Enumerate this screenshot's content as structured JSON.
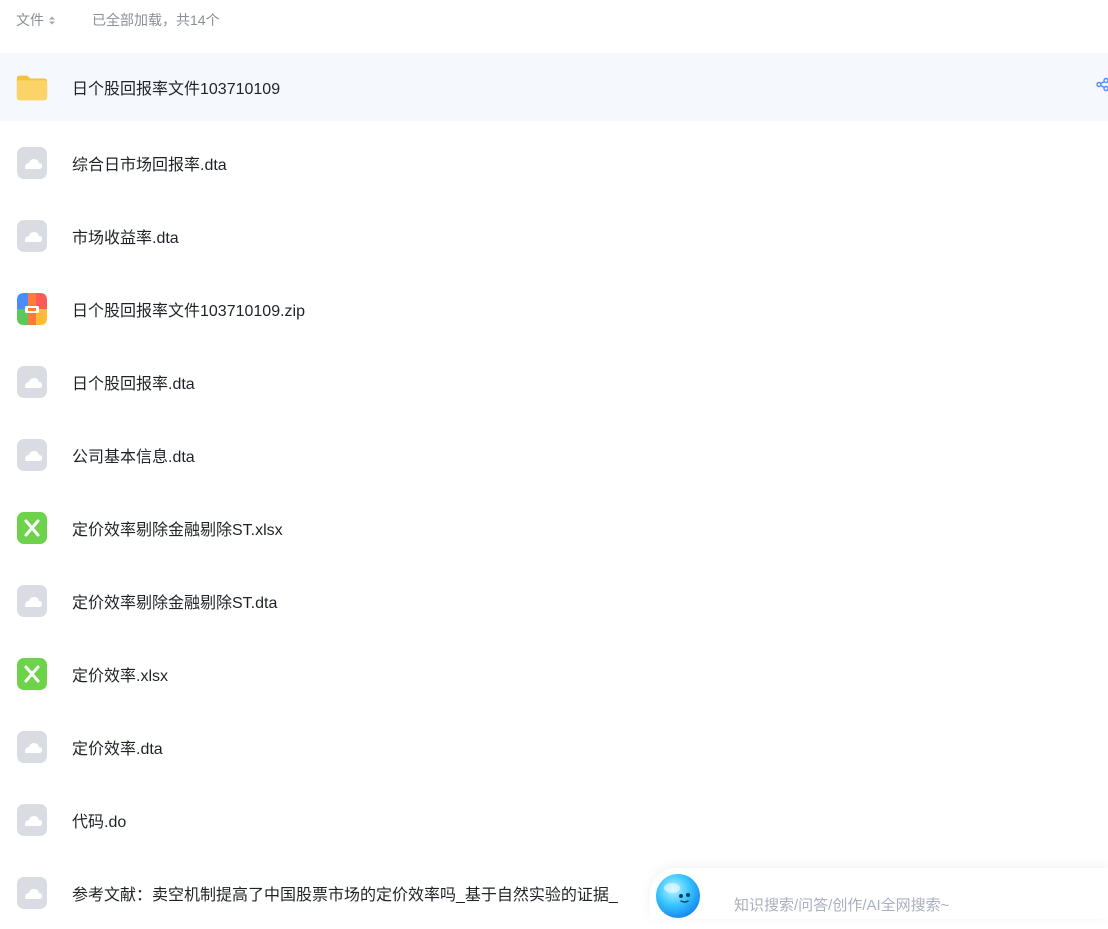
{
  "header": {
    "sort_label": "文件",
    "loaded_text": "已全部加载，共14个"
  },
  "files": [
    {
      "name": "日个股回报率文件103710109",
      "icon": "folder-icon"
    },
    {
      "name": "综合日市场回报率.dta",
      "icon": "generic-file-icon"
    },
    {
      "name": "市场收益率.dta",
      "icon": "generic-file-icon"
    },
    {
      "name": "日个股回报率文件103710109.zip",
      "icon": "zip-icon"
    },
    {
      "name": "日个股回报率.dta",
      "icon": "generic-file-icon"
    },
    {
      "name": "公司基本信息.dta",
      "icon": "generic-file-icon"
    },
    {
      "name": "定价效率剔除金融剔除ST.xlsx",
      "icon": "excel-icon"
    },
    {
      "name": "定价效率剔除金融剔除ST.dta",
      "icon": "generic-file-icon"
    },
    {
      "name": "定价效率.xlsx",
      "icon": "excel-icon"
    },
    {
      "name": "定价效率.dta",
      "icon": "generic-file-icon"
    },
    {
      "name": "代码.do",
      "icon": "generic-file-icon"
    },
    {
      "name": "参考文献：卖空机制提高了中国股票市场的定价效率吗_基于自然实验的证据_",
      "icon": "generic-file-icon"
    }
  ],
  "ai_search": {
    "placeholder": "知识搜索/问答/创作/AI全网搜索~",
    "icon": "ai-assistant-icon"
  },
  "colors": {
    "selected_row": "#f5f8fd",
    "folder": "#fbd15f",
    "excel": "#6dd34b",
    "generic_file": "#d9dde3",
    "accent": "#4a8bff"
  }
}
